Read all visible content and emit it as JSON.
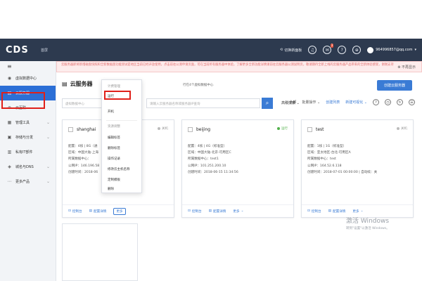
{
  "topbar": {
    "logo": "CDS",
    "brand": "首屏",
    "switch_console": "切换新面板",
    "notif_count": "3"
  },
  "user": {
    "email": "964996857@qq.com"
  },
  "sidebar": {
    "toggle_icon": "menu-icon",
    "items": [
      {
        "label": "虚拟数据中心",
        "arrow": false
      },
      {
        "label": "云服务器",
        "arrow": false
      },
      {
        "label": "云互联",
        "arrow": false
      },
      {
        "label": "管理工具",
        "arrow": true
      },
      {
        "label": "存储与分发",
        "arrow": true
      },
      {
        "label": "私有IT部件",
        "arrow": false
      },
      {
        "label": "城名与DNS",
        "arrow": true
      },
      {
        "label": "更多产品",
        "arrow": true
      }
    ]
  },
  "notice": {
    "text": "云服务器即将新增磁盘快照和全新数据盘功能测试是地区当前已经开放使用，点击前往公测申请页面，可在当前所有服务器中体验，了解更多全新功能详情请前往云服务器公测说明页，敬请期待全新上线的云服务器产品带来的全新体验感受，谢谢支持",
    "dismiss": "不再显示"
  },
  "page": {
    "title": "云服务器",
    "sub": "行在4个虚拟数据中心",
    "create_button": "创建云服务器"
  },
  "filters": {
    "region_placeholder": "虚拟数据中心",
    "search_placeholder": "请输入云服务器名称或服务器IP查询",
    "advanced": "高级搜索",
    "all": "全部",
    "batch": "批量操作",
    "bulk_create": "创建列表",
    "new_create": "新建可视化"
  },
  "dropdown": {
    "group1": "计费管理",
    "items1": [
      "运行",
      "开机"
    ],
    "group2": "资源调整",
    "items2": [
      "编辑标签",
      "删除标签",
      "操作记录",
      "修改云主机名称",
      "定制模板",
      "删除"
    ]
  },
  "cards": [
    {
      "name": "shanghai",
      "status": "关机",
      "running": false,
      "lines": [
        "配置：4核 | 8G（通",
        "区域：中国大陆-上海",
        "所属数据中心：",
        "公网IP：146.196.58",
        "创建时间：2018-06"
      ],
      "actions": [
        "控制台",
        "配置详情",
        "更多"
      ]
    },
    {
      "name": "beijing",
      "status": "运行",
      "running": true,
      "lines": [
        "配置：4核 | 4G（标准型）",
        "区域：中国大陆-北京-可用区C",
        "所属数据中心：test1",
        "公网IP：101.251.200.10",
        "创建时间：2018-06-15 11:34:56"
      ],
      "actions": [
        "控制台",
        "配置详情",
        "更多"
      ]
    },
    {
      "name": "test",
      "status": "关机",
      "running": false,
      "lines": [
        "配置：1核 | 1G（标准型）",
        "区域：亚太地区-台北-可用区A",
        "所属数据中心：test",
        "公网IP：164.52.6.118",
        "创建时间：2018-07-01 00:00:00 | 自动续：关"
      ],
      "actions": [
        "控制台",
        "配置详情",
        "更多"
      ]
    }
  ],
  "watermark": {
    "line1": "激活 Windows",
    "line2": "转到\"设置\"以激活 Windows。"
  },
  "colors": {
    "topbar": "#2d3a4f",
    "accent": "#3a7bd5",
    "sidebar_active": "#2c6fd6",
    "highlight": "#e0201a",
    "running": "#52b14b"
  }
}
